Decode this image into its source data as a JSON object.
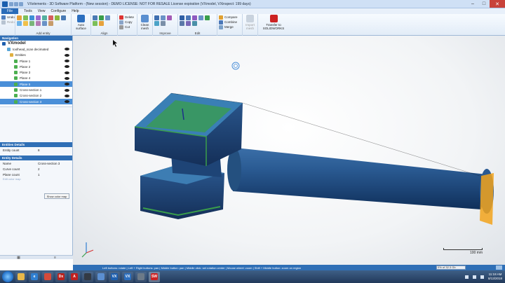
{
  "window": {
    "title": "VXelements - 3D Software Platform - (New session) - DEMO LICENSE: NOT FOR RESALE License expiration (VXmodel, VXinspect: 199 days)"
  },
  "menu": {
    "file": "File",
    "tabs": [
      "Tools",
      "View",
      "Configure",
      "Help"
    ]
  },
  "ribbon": {
    "undo": "Undo",
    "redo": "Redo",
    "add_entity": "Add entity",
    "auto_surface": "Auto surface",
    "align": "Align",
    "delete": "Delete",
    "copy": "Copy",
    "cut": "Cut",
    "clean_mesh": "Clean mesh",
    "improve": "Improve",
    "edit": "Edit",
    "compare": "Compare",
    "combine": "Combine",
    "merge": "Merge",
    "transfer_to_cad": "Transfer to SOLIDWORKS",
    "import_mesh": "Import mesh"
  },
  "navigation": {
    "header": "Navigation",
    "root": "VXmodel",
    "items": [
      {
        "label": "toolhead_scan decimated",
        "selected": false,
        "color": "#5aa7d8"
      },
      {
        "label": "Entities",
        "selected": false,
        "color": "#e0b040"
      },
      {
        "label": "Plane 1",
        "selected": false,
        "color": "#4caf50"
      },
      {
        "label": "Plane 2",
        "selected": false,
        "color": "#4caf50"
      },
      {
        "label": "Plane 3",
        "selected": false,
        "color": "#4caf50"
      },
      {
        "label": "Plane 4",
        "selected": false,
        "color": "#4caf50"
      },
      {
        "label": "Plane 5",
        "selected": true,
        "color": "#4caf50"
      },
      {
        "label": "Cross-section 1",
        "selected": false,
        "color": "#4caf50"
      },
      {
        "label": "Cross-section 2",
        "selected": false,
        "color": "#4caf50"
      },
      {
        "label": "Cross-section 3",
        "selected": true,
        "color": "#4caf50"
      }
    ]
  },
  "entities_details": {
    "header": "Entities Details",
    "entity_count_label": "Entity count",
    "entity_count_value": "8"
  },
  "entity_details": {
    "header": "Entity Details",
    "rows": [
      {
        "key": "Name",
        "value": "Cross-section 3"
      },
      {
        "key": "Curve count",
        "value": "2"
      },
      {
        "key": "Plane count",
        "value": "1"
      }
    ],
    "edit_color_map": "Edit color map",
    "show_color_map": "Show color map"
  },
  "scale": {
    "label": "100 mm"
  },
  "status": {
    "hint": "Left buttons: rotate | Left + Right buttons: pan | Middle button: pan | Middle click: set rotation center | Mouse wheel: zoom | Shift + Middle button: zoom on region",
    "progress_text": "0% of 32.3 Gb",
    "memory_used_fraction": 0.0
  },
  "taskbar": {
    "time": "11:18 AM",
    "date": "8/13/2018",
    "apps": [
      {
        "name": "explorer",
        "glyph": "",
        "color": "#e8b84a"
      },
      {
        "name": "ie",
        "glyph": "e",
        "color": "#2f7fd1"
      },
      {
        "name": "chrome",
        "glyph": "",
        "color": "#d64a3a"
      },
      {
        "name": "dx",
        "glyph": "Dx",
        "color": "#b8221e"
      },
      {
        "name": "acrobat",
        "glyph": "A",
        "color": "#c0201e"
      },
      {
        "name": "steam",
        "glyph": "",
        "color": "#333a44"
      },
      {
        "name": "sw-logo",
        "glyph": "",
        "color": "#5b8fd1"
      },
      {
        "name": "vk",
        "glyph": "VX",
        "color": "#1e5fae"
      },
      {
        "name": "vx2",
        "glyph": "VX",
        "color": "#2c6fbf"
      },
      {
        "name": "generic",
        "glyph": "",
        "color": "#6c7a88"
      },
      {
        "name": "solidworks",
        "glyph": "SW",
        "color": "#cc2222"
      }
    ]
  },
  "colors": {
    "accent": "#2f6fb6",
    "mesh_blue": "#1f4e8c",
    "plane_green": "#3a9e4b",
    "cross_orange": "#f2a31b"
  }
}
